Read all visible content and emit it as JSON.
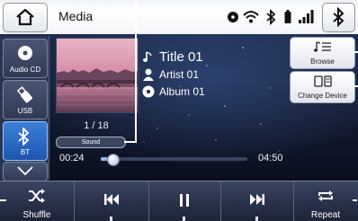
{
  "header": {
    "title": "Media",
    "home_icon": "home-icon",
    "status_icons": [
      "disc-status-icon",
      "wifi-icon",
      "bluetooth-status-icon",
      "battery-icon",
      "signal-bars-icon"
    ],
    "bluetooth_button_icon": "bluetooth-icon"
  },
  "sources": {
    "items": [
      {
        "label": "Audio CD",
        "icon": "disc-icon",
        "active": false
      },
      {
        "label": "USB",
        "icon": "usb-icon",
        "active": false
      },
      {
        "label": "BT",
        "icon": "bluetooth-icon",
        "active": true
      }
    ],
    "scroll_icon": "chevron-down-icon"
  },
  "now_playing": {
    "counter": "1 / 18",
    "sound_label": "Sound",
    "title": "Title 01",
    "artist": "Artist 01",
    "album": "Album 01",
    "elapsed": "00:24",
    "duration": "04:50",
    "progress": 0.08
  },
  "side_buttons": {
    "browse": "Browse",
    "change_device": "Change Device"
  },
  "controls": {
    "shuffle": "Shuffle",
    "prev_icon": "skip-previous-icon",
    "pause_icon": "pause-icon",
    "next_icon": "skip-next-icon",
    "repeat": "Repeat"
  },
  "colors": {
    "active_source": "#2f6cc8",
    "background": "#141c33",
    "header": "#ffffff"
  }
}
